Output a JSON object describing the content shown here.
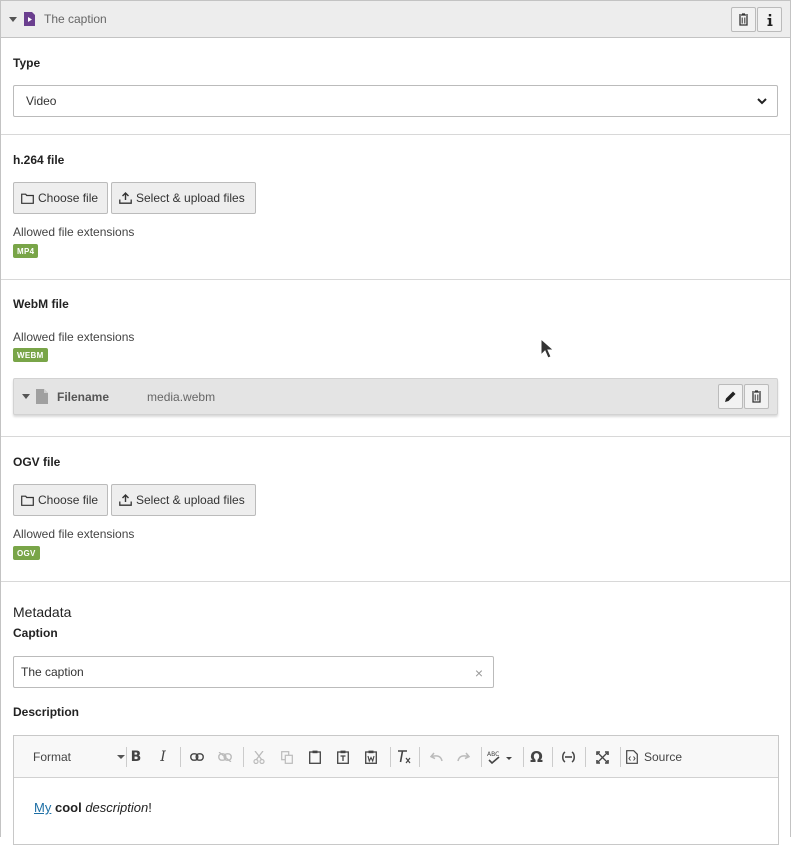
{
  "header": {
    "title": "The caption",
    "icons": [
      "delete-icon",
      "info-icon"
    ]
  },
  "type_field": {
    "label": "Type",
    "value": "Video"
  },
  "h264": {
    "label": "h.264 file",
    "choose_label": "Choose file",
    "upload_label": "Select & upload files",
    "hint": "Allowed file extensions",
    "badge": "MP4"
  },
  "webm": {
    "label": "WebM file",
    "hint": "Allowed file extensions",
    "badge": "WEBM",
    "file": {
      "label": "Filename",
      "value": "media.webm"
    }
  },
  "ogv": {
    "label": "OGV file",
    "choose_label": "Choose file",
    "upload_label": "Select & upload files",
    "hint": "Allowed file extensions",
    "badge": "OGV"
  },
  "metadata": {
    "heading": "Metadata",
    "caption_label": "Caption",
    "caption_value": "The caption",
    "description_label": "Description",
    "toolbar": {
      "format_label": "Format",
      "source_label": "Source"
    },
    "description": {
      "link": "My",
      "bold": "cool",
      "italic": "description",
      "end": "!"
    }
  },
  "colors": {
    "badge": "#79a548",
    "header_bg": "#ededed",
    "doc_icon": "#6b3f8f",
    "link": "#1d6fa5"
  }
}
